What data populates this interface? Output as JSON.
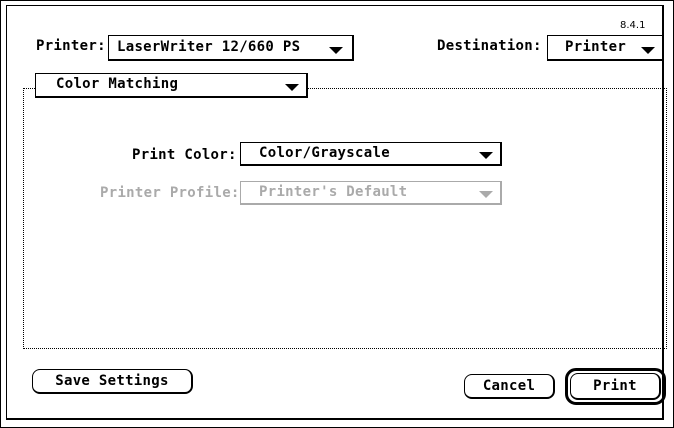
{
  "version": "8.4.1",
  "printer": {
    "label": "Printer:",
    "value": "LaserWriter 12/660 PS"
  },
  "destination": {
    "label": "Destination:",
    "value": "Printer"
  },
  "panel": {
    "value": "Color Matching"
  },
  "print_color": {
    "label": "Print Color:",
    "value": "Color/Grayscale"
  },
  "printer_profile": {
    "label": "Printer Profile:",
    "value": "Printer's Default",
    "enabled": false
  },
  "buttons": {
    "save_settings": "Save Settings",
    "cancel": "Cancel",
    "print": "Print"
  }
}
